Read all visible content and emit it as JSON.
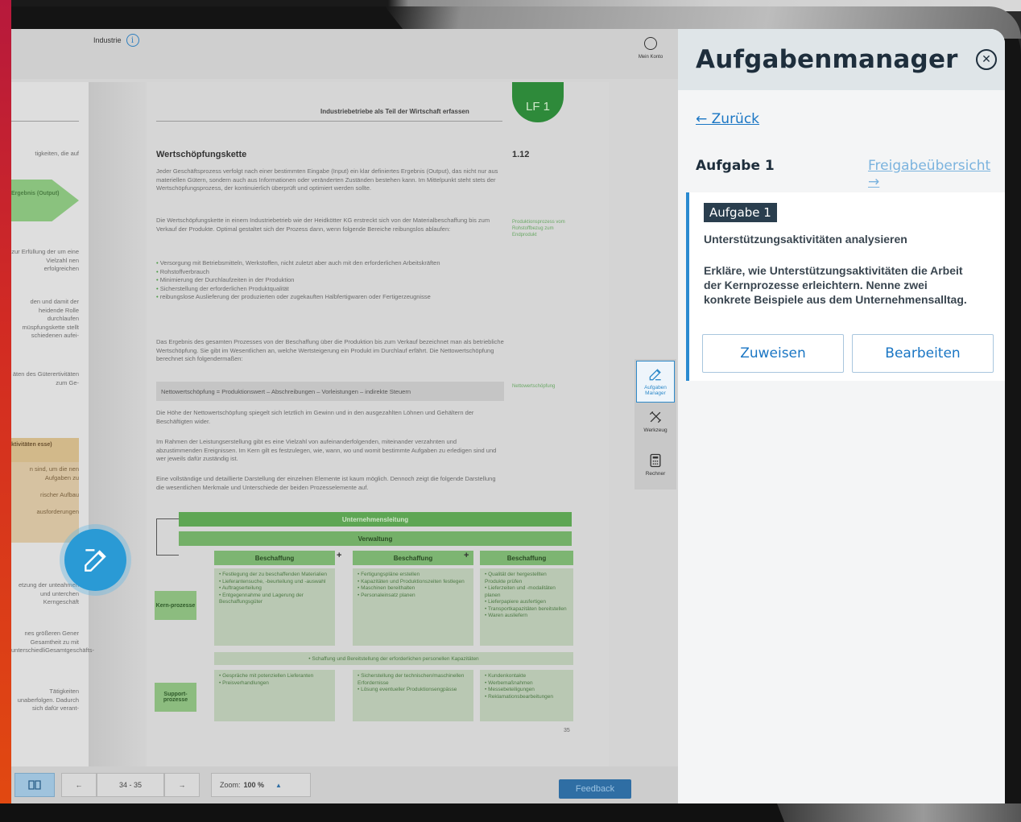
{
  "book": {
    "breadcrumb": "Industrie",
    "account_label": "Mein Konto",
    "running_head": "Industriebetriebe als Teil der Wirtschaft erfassen",
    "chapter_badge": "LF 1",
    "section_title": "Wertschöpfungskette",
    "section_number": "1.12",
    "para1": "Jeder Geschäftsprozess verfolgt nach einer bestimmten Eingabe (Input) ein klar definiertes Ergebnis (Output), das nicht nur aus materiellen Gütern, sondern auch aus Informationen oder veränderten Zuständen bestehen kann. Im Mittelpunkt steht stets der Wertschöpfungsprozess, der kontinuierlich überprüft und optimiert werden sollte.",
    "para2": "Die Wertschöpfungskette in einem Industriebetrieb wie der Heidkötter KG erstreckt sich von der Materialbeschaffung bis zum Verkauf der Produkte. Optimal gestaltet sich der Prozess dann, wenn folgende Bereiche reibungslos ablaufen:",
    "bullets": [
      "Versorgung mit Betriebsmitteln, Werkstoffen, nicht zuletzt aber auch mit den erforderlichen Arbeitskräften",
      "Rohstoffverbrauch",
      "Minimierung der Durchlaufzeiten in der Produktion",
      "Sicherstellung der erforderlichen Produktqualität",
      "reibungslose Auslieferung der produzierten oder zugekauften Halbfertigwaren oder Fertigerzeugnisse"
    ],
    "para3": "Das Ergebnis des gesamten Prozesses von der Beschaffung über die Produktion bis zum Verkauf bezeichnet man als betriebliche Wertschöpfung. Sie gibt im Wesentlichen an, welche Wertsteigerung ein Produkt im Durchlauf erfährt. Die Nettowertschöpfung berechnet sich folgendermaßen:",
    "formula": "Nettowertschöpfung = Produktionswert – Abschreibungen – Vorleistungen – indirekte Steuern",
    "para4": "Die Höhe der Nettowertschöpfung spiegelt sich letztlich im Gewinn und in den ausgezahlten Löhnen und Gehältern der Beschäftigten wider.",
    "para5": "Im Rahmen der Leistungserstellung gibt es eine Vielzahl von aufeinanderfolgenden, miteinander verzahnten und abzustimmenden Ereignissen. Im Kern gilt es festzulegen, wie, wann, wo und womit bestimmte Aufgaben zu erledigen sind und wer jeweils dafür zuständig ist.",
    "para6": "Eine vollständige und detaillierte Darstellung der einzelnen Elemente ist kaum möglich. Dennoch zeigt die folgende Darstellung die wesentlichen Merkmale und Unterschiede der beiden Prozesselemente auf.",
    "margin_note1": "Produktionsprozess vom Rohstoffbezug zum Endprodukt",
    "margin_note2": "Nettowertschöpfung",
    "page_number": "35",
    "diagram": {
      "top_bar": "Unternehmensleitung",
      "mid_bar": "Verwaltung",
      "col_heads": [
        "Beschaffung",
        "Beschaffung",
        "Beschaffung"
      ],
      "plus": "+",
      "kern_label": "Kern-prozesse",
      "support_label": "Support-prozesse",
      "kern_cols": [
        "• Festlegung der zu beschaffenden Materialien\n• Lieferantensuche, -beurteilung und -auswahl\n• Auftragserteilung\n• Entgegennahme und Lagerung der Beschaffungsgüter",
        "• Fertigungspläne erstellen\n• Kapazitäten und Produktionszeiten festlegen\n• Maschinen bereithalten\n• Personaleinsatz planen",
        "• Qualität der hergestellten Produkte prüfen\n• Lieferzeiten und -modalitäten planen\n• Lieferpapiere ausfertigen\n• Transportkapazitäten bereitstellen\n• Waren ausliefern"
      ],
      "support_line": "• Schaffung und Bereitstellung der erforderlichen personellen Kapazitäten",
      "support_cols": [
        "• Gespräche mit potenziellen Lieferanten\n• Preisverhandlungen",
        "• Sicherstellung der technischen/maschinellen Erfordernisse\n• Lösung eventueller Produktionsengpässe",
        "• Kundenkontakte\n• Werbemaßnahmen\n• Messebeteiligungen\n• Reklamationsbearbeitungen"
      ]
    },
    "left_page": {
      "line1": "tigkeiten, die auf",
      "arrow_label": "Ergebnis (Output)",
      "block1": "zur Erfüllung der um eine Vielzahl nen erfolgreichen",
      "block2": "den und damit der heidende Rolle durchlaufen müspfungskette stellt schiedenen aufei-",
      "block3": "äten des Güterertivitäten zum Ge-",
      "box_head": "ktivitäten esse)",
      "box_text": "n sind, um die nen Aufgaben zu\n\nrischer Aufbau\n\nausforderungen",
      "block4": "etzung der unteahmen und unterchen Kerngeschäft",
      "block5": "nes größeren Gener Gesamtheit zu mit unterschiedliGesamtgeschäfts-",
      "block6": "Tätigkeiten unaberfolgen. Dadurch sich dafür verant-"
    }
  },
  "dock": {
    "items": [
      {
        "label": "Aufgaben Manager",
        "icon": "edit-icon"
      },
      {
        "label": "Werkzeug",
        "icon": "tools-icon"
      },
      {
        "label": "Rechner",
        "icon": "calculator-icon"
      }
    ]
  },
  "toolbar": {
    "page_range": "34 - 35",
    "zoom_label": "Zoom:",
    "zoom_value": "100 %",
    "feedback_label": "Feedback"
  },
  "panel": {
    "title": "Aufgabenmanager",
    "close_symbol": "✕",
    "back_label": "← Zurück",
    "task_title": "Aufgabe 1",
    "release_label": "Freigabeübersicht →",
    "card": {
      "tag": "Aufgabe 1",
      "subtitle": "Unterstützungsaktivitäten analysieren",
      "body": "Erkläre, wie Unterstützungsaktivitäten die Arbeit der Kernprozesse erleichtern. Nenne zwei konkrete Beispiele aus dem Unternehmensalltag.",
      "assign_label": "Zuweisen",
      "edit_label": "Bearbeiten"
    }
  },
  "colors": {
    "accent": "#1a76c4",
    "panel_title": "#1e2e3c",
    "tag_bg": "#2a3e4e",
    "fab": "#2a9ad5",
    "green": "#5ea654"
  }
}
